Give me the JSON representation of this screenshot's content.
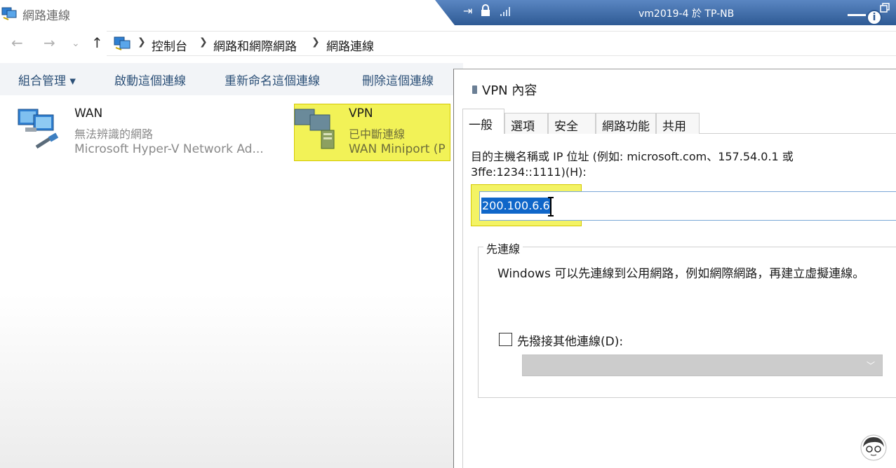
{
  "explorer": {
    "window_title": "網路連線",
    "breadcrumb": [
      "控制台",
      "網路和網際網路",
      "網路連線"
    ],
    "nav": {
      "back": "←",
      "forward": "→",
      "recent": "⌄",
      "up": "↑"
    },
    "commands": [
      "組合管理 ▾",
      "啟動這個連線",
      "重新命名這個連線",
      "刪除這個連線"
    ],
    "connections": [
      {
        "name": "WAN",
        "status": "無法辨識的網路",
        "device": "Microsoft Hyper-V Network Ad...",
        "icon": "network-adapter-icon"
      },
      {
        "name": "VPN",
        "status": "已中斷連線",
        "device": "WAN Miniport (P",
        "icon": "vpn-connection-icon"
      }
    ]
  },
  "rdp": {
    "title": "vm2019-4 於 TP-NB",
    "accent": "#2e5a94"
  },
  "dialog": {
    "title": "VPN 內容",
    "tabs": [
      "一般",
      "選項",
      "安全性",
      "網路功能",
      "共用"
    ],
    "active_tab": "一般",
    "host_label": "目的主機名稱或 IP 位址 (例如: microsoft.com、157.54.0.1 或 3ffe:1234::1111)(H):",
    "host_value": "200.100.6.6",
    "group_title": "先連線",
    "group_text": "Windows 可以先連線到公用網路，例如網際網路，再建立虛擬連線。",
    "checkbox_label": "先撥接其他連線(D):",
    "checkbox_checked": false
  },
  "colors": {
    "highlight": "#eeee28",
    "selection": "#0f66c9",
    "command_text": "#2b4f77"
  }
}
